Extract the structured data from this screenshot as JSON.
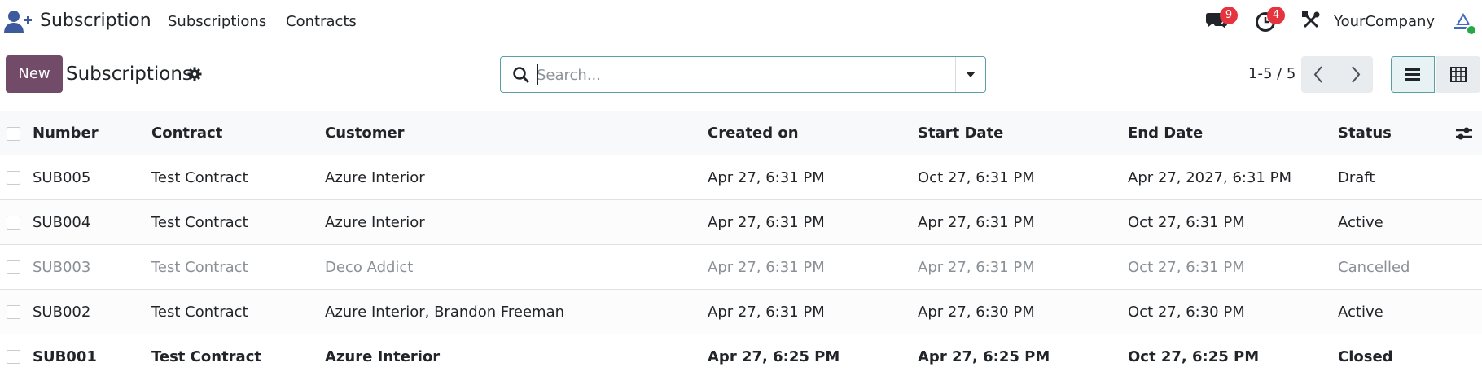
{
  "navbar": {
    "app_name": "Subscription",
    "menu": [
      {
        "label": "Subscriptions"
      },
      {
        "label": "Contracts"
      }
    ],
    "messages_badge": "9",
    "activities_badge": "4",
    "company_name": "YourCompany",
    "colors": {
      "badge": "#e4343d",
      "app_icon": "#3d5a9e",
      "online": "#28a745"
    }
  },
  "control_panel": {
    "new_label": "New",
    "title": "Subscriptions",
    "search_placeholder": "Search...",
    "pager_value": "1-5 / 5",
    "colors": {
      "primary": "#714b67",
      "accent": "#5a9fa3"
    }
  },
  "table": {
    "columns": [
      "Number",
      "Contract",
      "Customer",
      "Created on",
      "Start Date",
      "End Date",
      "Status"
    ],
    "rows": [
      {
        "number": "SUB005",
        "contract": "Test Contract",
        "customer": "Azure Interior",
        "created_on": "Apr 27, 6:31 PM",
        "start_date": "Oct 27, 6:31 PM",
        "end_date": "Apr 27, 2027, 6:31 PM",
        "status": "Draft"
      },
      {
        "number": "SUB004",
        "contract": "Test Contract",
        "customer": "Azure Interior",
        "created_on": "Apr 27, 6:31 PM",
        "start_date": "Apr 27, 6:31 PM",
        "end_date": "Oct 27, 6:31 PM",
        "status": "Active"
      },
      {
        "number": "SUB003",
        "contract": "Test Contract",
        "customer": "Deco Addict",
        "created_on": "Apr 27, 6:31 PM",
        "start_date": "Apr 27, 6:31 PM",
        "end_date": "Oct 27, 6:31 PM",
        "status": "Cancelled"
      },
      {
        "number": "SUB002",
        "contract": "Test Contract",
        "customer": "Azure Interior, Brandon Freeman",
        "created_on": "Apr 27, 6:31 PM",
        "start_date": "Apr 27, 6:30 PM",
        "end_date": "Oct 27, 6:30 PM",
        "status": "Active"
      },
      {
        "number": "SUB001",
        "contract": "Test Contract",
        "customer": "Azure Interior",
        "created_on": "Apr 27, 6:25 PM",
        "start_date": "Apr 27, 6:25 PM",
        "end_date": "Oct 27, 6:25 PM",
        "status": "Closed"
      }
    ]
  }
}
